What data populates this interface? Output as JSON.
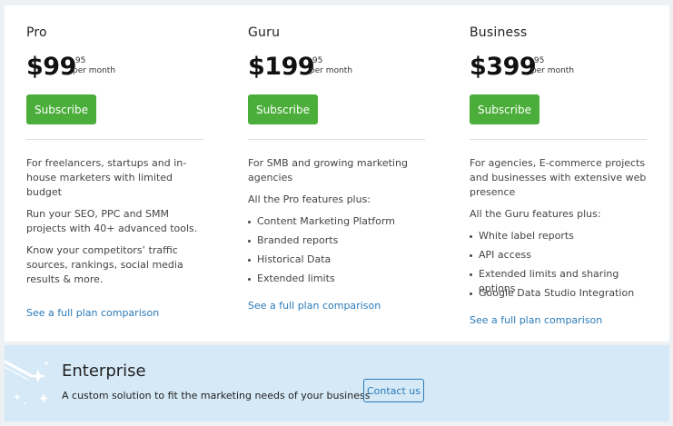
{
  "plans": [
    {
      "name": "Pro",
      "price": "$99",
      "cents": ".95",
      "period": "per month",
      "subscribe_label": "Subscribe",
      "paragraphs": [
        "For freelancers, startups and in-house marketers with limited budget",
        "Run your SEO, PPC and SMM projects with 40+ advanced tools.",
        "Know your competitors’ traffic sources, rankings, social media results & more."
      ],
      "features": [],
      "compare_link": "See a full plan comparison"
    },
    {
      "name": "Guru",
      "price": "$199",
      "cents": ".95",
      "period": "per month",
      "subscribe_label": "Subscribe",
      "paragraphs": [
        "For SMB and growing marketing agencies",
        "All the Pro features plus:"
      ],
      "features": [
        "Content Marketing Platform",
        "Branded reports",
        "Historical Data",
        "Extended limits"
      ],
      "compare_link": "See a full plan comparison"
    },
    {
      "name": "Business",
      "price": "$399",
      "cents": ".95",
      "period": "per month",
      "subscribe_label": "Subscribe",
      "paragraphs": [
        "For agencies, E-commerce projects and businesses with extensive web presence",
        "All the Guru features plus:"
      ],
      "features": [
        "White label reports",
        "API access",
        "Extended limits and sharing options",
        "Google Data Studio Integration"
      ],
      "compare_link": "See a full plan comparison"
    }
  ],
  "enterprise": {
    "title": "Enterprise",
    "subtitle": "A custom solution to fit the marketing needs of your business",
    "contact_label": "Contact us"
  },
  "colors": {
    "button_green": "#4bae3a",
    "link_blue": "#2a7ab8",
    "enterprise_bg": "#d5e9f7",
    "page_bg": "#eef1f4"
  },
  "icons": {
    "enterprise": "sparkle-wand-icon",
    "feature_bullet": "bullet-dot-icon"
  }
}
